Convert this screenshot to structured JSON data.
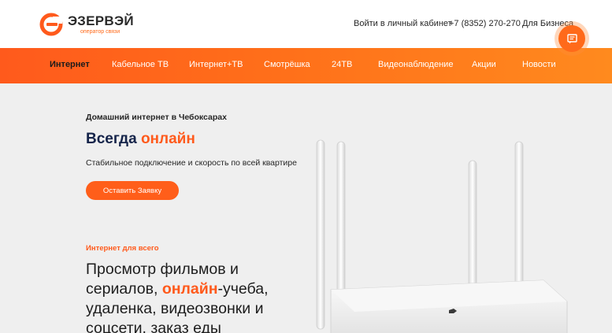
{
  "brand": {
    "name": "ЭЗЕРВЭЙ",
    "tagline": "оператор связи",
    "accent_color": "#ff5a1c"
  },
  "header": {
    "cabinet_link": "Войти в личный кабинет",
    "phone": "+7 (8352) 270-270",
    "business_link": "Для Бизнеса"
  },
  "nav": {
    "items": [
      {
        "label": "Интернет",
        "active": true
      },
      {
        "label": "Кабельное ТВ",
        "active": false
      },
      {
        "label": "Интернет+ТВ",
        "active": false
      },
      {
        "label": "Смотрёшка",
        "active": false
      },
      {
        "label": "24ТВ",
        "active": false
      },
      {
        "label": "Видеонаблюдение",
        "active": false
      },
      {
        "label": "Акции",
        "active": false
      },
      {
        "label": "Новости",
        "active": false
      }
    ]
  },
  "fab": {
    "icon": "chat-icon"
  },
  "hero": {
    "subtitle": "Домашний интернет в Чебоксарах",
    "title_main": "Всегда ",
    "title_accent": "онлайн",
    "description": "Стабильное подключение и скорость по всей квартире",
    "cta_label": "Оставить Заявку"
  },
  "section": {
    "label": "Интернет для всего",
    "text_part1": "Просмотр фильмов и сериалов, ",
    "text_accent": "онлайн",
    "text_part2": "-учеба, удаленка, видеозвонки и соцсети, заказ еды"
  },
  "illustration": {
    "icon": "wifi-router-image"
  }
}
